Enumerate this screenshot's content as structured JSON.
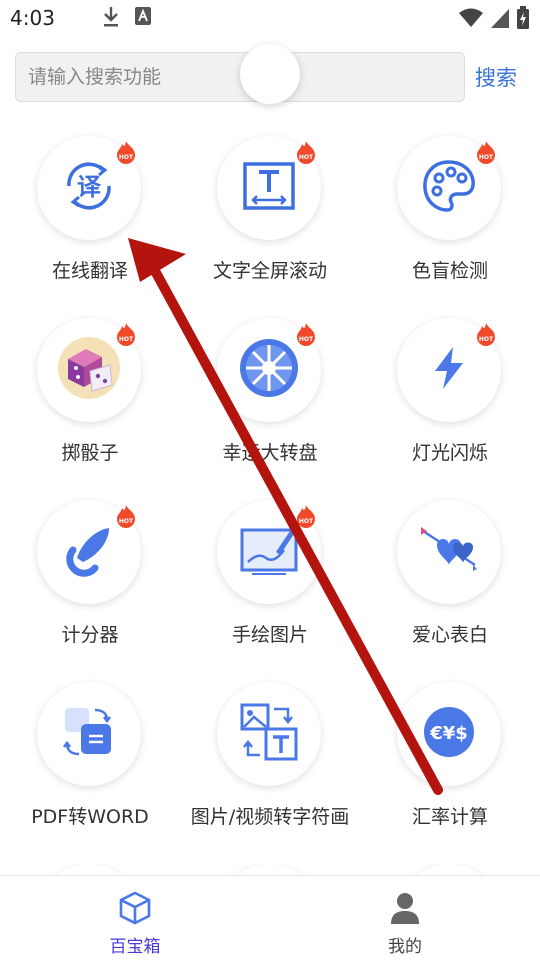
{
  "status": {
    "time": "4:03",
    "icons": [
      "download-icon",
      "app-notification-icon",
      "wifi-icon",
      "signal-icon",
      "battery-charging-icon"
    ]
  },
  "search": {
    "placeholder": "请输入搜索功能",
    "button_label": "搜索"
  },
  "tools": [
    {
      "label": "在线翻译",
      "icon": "translate-icon",
      "hot": true
    },
    {
      "label": "文字全屏滚动",
      "icon": "text-scroll-icon",
      "hot": true
    },
    {
      "label": "色盲检测",
      "icon": "palette-icon",
      "hot": true
    },
    {
      "label": "掷骰子",
      "icon": "dice-icon",
      "hot": true
    },
    {
      "label": "幸运大转盘",
      "icon": "wheel-icon",
      "hot": true
    },
    {
      "label": "灯光闪烁",
      "icon": "lightning-icon",
      "hot": true
    },
    {
      "label": "计分器",
      "icon": "feather-counter-icon",
      "hot": true
    },
    {
      "label": "手绘图片",
      "icon": "drawing-board-icon",
      "hot": true
    },
    {
      "label": "爱心表白",
      "icon": "hearts-arrow-icon",
      "hot": false
    },
    {
      "label": "PDF转WORD",
      "icon": "pdf-word-icon",
      "hot": false
    },
    {
      "label": "图片/视频转字符画",
      "icon": "image-to-text-icon",
      "hot": false
    },
    {
      "label": "汇率计算",
      "icon": "currency-icon",
      "hot": false
    }
  ],
  "nav": {
    "items": [
      {
        "label": "百宝箱",
        "icon": "cube-icon",
        "active": true
      },
      {
        "label": "我的",
        "icon": "user-icon",
        "active": false
      }
    ]
  },
  "colors": {
    "accent": "#4a3ad8",
    "search_link": "#3a74d8",
    "icon_blue": "#3d6fe0",
    "hot": "#f04a2a",
    "annotation": "#b3140e"
  }
}
